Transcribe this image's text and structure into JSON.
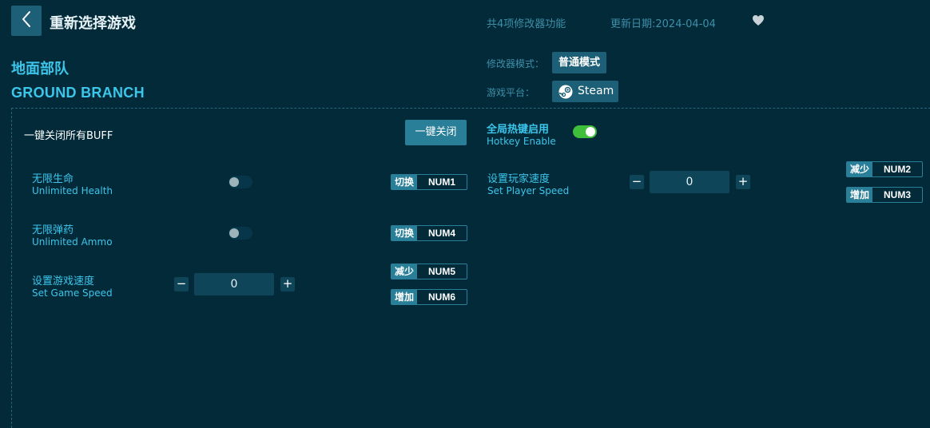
{
  "header": {
    "title": "重新选择游戏",
    "feature_count": "共4项修改器功能",
    "update_date": "更新日期:2024-04-04"
  },
  "game": {
    "name_cn": "地面部队",
    "name_en": "GROUND BRANCH"
  },
  "settings": {
    "mode_label": "修改器模式：",
    "mode_value": "普通模式",
    "platform_label": "游戏平台：",
    "platform_value": "Steam"
  },
  "buff": {
    "label": "一键关闭所有BUFF",
    "button": "一键关闭"
  },
  "hotkey": {
    "label_cn": "全局热键启用",
    "label_en": "Hotkey Enable",
    "enabled": true
  },
  "cheats": [
    {
      "name_cn": "无限生命",
      "name_en": "Unlimited Health",
      "enabled": false,
      "keys": [
        {
          "action": "切换",
          "key": "NUM1"
        }
      ]
    },
    {
      "name_cn": "无限弹药",
      "name_en": "Unlimited Ammo",
      "enabled": false,
      "keys": [
        {
          "action": "切换",
          "key": "NUM4"
        }
      ]
    },
    {
      "name_cn": "设置游戏速度",
      "name_en": "Set Game Speed",
      "value": "0",
      "keys": [
        {
          "action": "减少",
          "key": "NUM5"
        },
        {
          "action": "增加",
          "key": "NUM6"
        }
      ]
    },
    {
      "name_cn": "设置玩家速度",
      "name_en": "Set Player Speed",
      "value": "0",
      "keys": [
        {
          "action": "减少",
          "key": "NUM2"
        },
        {
          "action": "增加",
          "key": "NUM3"
        }
      ]
    }
  ],
  "stepper": {
    "minus": "−",
    "plus": "+"
  },
  "icons": {
    "back": "chevron-left-icon",
    "favorite": "heart-icon",
    "platform": "steam-icon"
  },
  "colors": {
    "background": "#022a38",
    "accent": "#3cc6ec",
    "button": "#1c5f76",
    "toggle_on": "#3fbf3a"
  }
}
